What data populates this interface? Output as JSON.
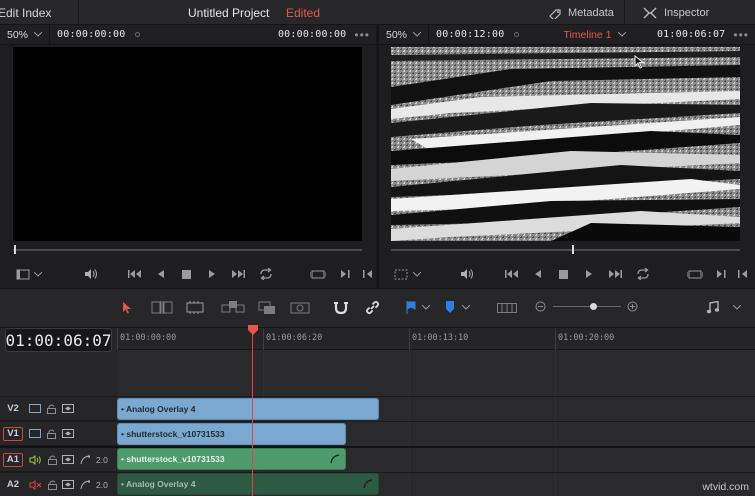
{
  "topbar": {
    "edit_index": "Edit Index",
    "project_title": "Untitled Project",
    "edited": "Edited",
    "metadata": "Metadata",
    "inspector": "Inspector"
  },
  "source_viewer": {
    "zoom": "50%",
    "timecode_left": "00:00:00:00",
    "timecode_right": "00:00:00:00",
    "scrub_position": 0.0
  },
  "timeline_viewer": {
    "zoom": "50%",
    "timecode_left": "00:00:12:00",
    "timeline_name": "Timeline 1",
    "timecode_right": "01:00:06:07",
    "scrub_position": 0.52
  },
  "timeline": {
    "current_timecode": "01:00:06:07",
    "ruler_labels": [
      "01:00:00:00",
      "01:00:06:20",
      "01:00:13:10",
      "01:00:20:00"
    ],
    "tracks": [
      {
        "name": "V2",
        "type": "video",
        "clips": [
          {
            "label": "• Analog Overlay 4"
          }
        ]
      },
      {
        "name": "V1",
        "type": "video",
        "clips": [
          {
            "label": "• shutterstock_v10731533"
          }
        ]
      },
      {
        "name": "A1",
        "type": "audio",
        "channels": "2.0",
        "clips": [
          {
            "label": "• shutterstock_v10731533"
          }
        ]
      },
      {
        "name": "A2",
        "type": "audio",
        "channels": "2.0",
        "clips": [
          {
            "label": "• Analog Overlay 4"
          }
        ]
      }
    ]
  },
  "colors": {
    "accent_red": "#e05a4a",
    "video_clip": "#7aa8cf",
    "audio_clip": "#4e9b6d",
    "flag_blue": "#2f7fe0"
  },
  "watermark": "wtvid.com"
}
